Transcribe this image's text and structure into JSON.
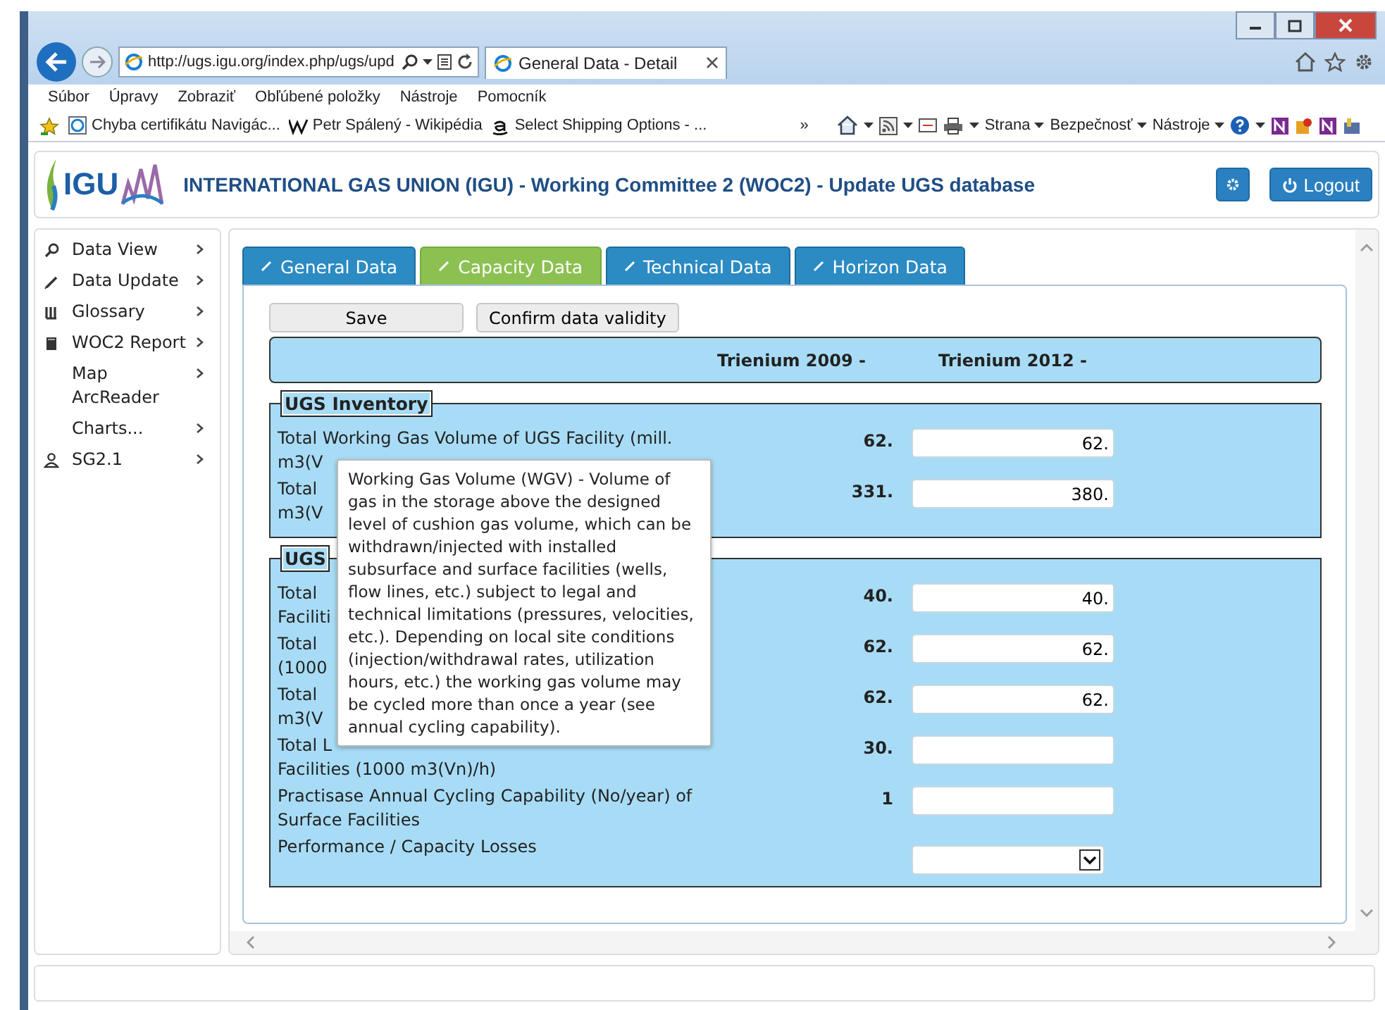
{
  "browser": {
    "address": "http://ugs.igu.org/index.php/ugs/upd",
    "tab_title": "General Data - Detail",
    "menu": [
      "Súbor",
      "Úpravy",
      "Zobraziť",
      "Obľúbené položky",
      "Nástroje",
      "Pomocník"
    ],
    "favorites": [
      {
        "kind": "page",
        "label": "Chyba certifikátu Navigác..."
      },
      {
        "kind": "wiki",
        "label": "Petr Spálený - Wikipédia"
      },
      {
        "kind": "shop",
        "label": "Select Shipping Options - ..."
      }
    ],
    "overflow": "»",
    "command_menus": [
      "Strana",
      "Bezpečnosť",
      "Nástroje"
    ]
  },
  "header": {
    "logo_text": "IGU",
    "title": "INTERNATIONAL GAS UNION (IGU) - Working Committee 2 (WOC2) - Update UGS database",
    "logout": "Logout"
  },
  "sidebar": {
    "items": [
      {
        "kind": "search",
        "label": "Data View"
      },
      {
        "kind": "pencil",
        "label": "Data Update"
      },
      {
        "kind": "columns",
        "label": "Glossary"
      },
      {
        "kind": "book",
        "label": "WOC2 Report"
      },
      {
        "kind": "plain",
        "label": "Map ArcReader"
      },
      {
        "kind": "plain",
        "label": "Charts..."
      },
      {
        "kind": "person",
        "label": "SG2.1"
      }
    ]
  },
  "tabs": [
    {
      "label": "General Data",
      "selected": false
    },
    {
      "label": "Capacity Data",
      "selected": true
    },
    {
      "label": "Technical Data",
      "selected": false
    },
    {
      "label": "Horizon Data",
      "selected": false
    }
  ],
  "actions": [
    "Save",
    "Confirm data validity"
  ],
  "columns": [
    "Trienium 2009 -",
    "Trienium 2012 -"
  ],
  "sections": [
    {
      "legend": "UGS Inventory",
      "rows": [
        {
          "kind": "input",
          "label_lines": [
            "Total Working Gas Volume of UGS Facility (mill.",
            "m3(V"
          ],
          "previous": "62.",
          "value": "62."
        },
        {
          "kind": "input",
          "label_lines": [
            "Total",
            "m3(V"
          ],
          "previous": "331.",
          "value": "380."
        }
      ]
    },
    {
      "legend": "UGS",
      "rows": [
        {
          "kind": "input",
          "label_lines": [
            "Total",
            "Faciliti"
          ],
          "previous": "40.",
          "value": "40."
        },
        {
          "kind": "input",
          "label_lines": [
            "Total",
            "(1000"
          ],
          "previous": "62.",
          "value": "62."
        },
        {
          "kind": "input",
          "label_lines": [
            "Total",
            "m3(V"
          ],
          "previous": "62.",
          "value": "62."
        },
        {
          "kind": "input",
          "label_lines": [
            "Total L",
            "Facilities (1000 m3(Vn)/h)"
          ],
          "previous": "30."
        },
        {
          "kind": "input",
          "label_lines": [
            "Practisase Annual Cycling Capability (No/year) of",
            "Surface Facilities"
          ],
          "previous": "1"
        },
        {
          "kind": "select",
          "label_lines": [
            "Performance / Capacity Losses"
          ]
        }
      ]
    }
  ],
  "tooltip": {
    "text": "Working Gas Volume (WGV) - Volume of gas in the storage above the designed level of cushion gas volume, which can be withdrawn/injected with installed subsurface and surface facilities (wells, flow lines, etc.) subject to legal and technical limitations (pressures, velocities, etc.). Depending on local site conditions (injection/withdrawal rates, utilization hours, etc.) the working gas volume may be cycled more than once a year (see annual cycling capability)."
  }
}
